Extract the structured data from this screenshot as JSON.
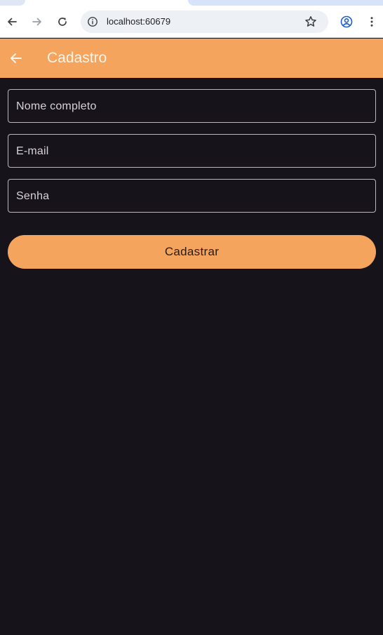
{
  "browser": {
    "url": "localhost:60679",
    "icons": {
      "back": "arrow-left-icon",
      "forward": "arrow-right-icon",
      "reload": "reload-icon",
      "site_info": "info-icon",
      "bookmark": "star-icon",
      "profile": "profile-icon",
      "menu": "kebab-menu-icon"
    }
  },
  "appbar": {
    "title": "Cadastro",
    "back_icon": "arrow-left-icon",
    "color": "#f4a45d"
  },
  "form": {
    "fields": [
      {
        "label": "Nome completo",
        "value": ""
      },
      {
        "label": "E-mail",
        "value": ""
      },
      {
        "label": "Senha",
        "value": ""
      }
    ],
    "submit_label": "Cadastrar"
  },
  "colors": {
    "accent": "#f4a45d",
    "background": "#16141a"
  }
}
